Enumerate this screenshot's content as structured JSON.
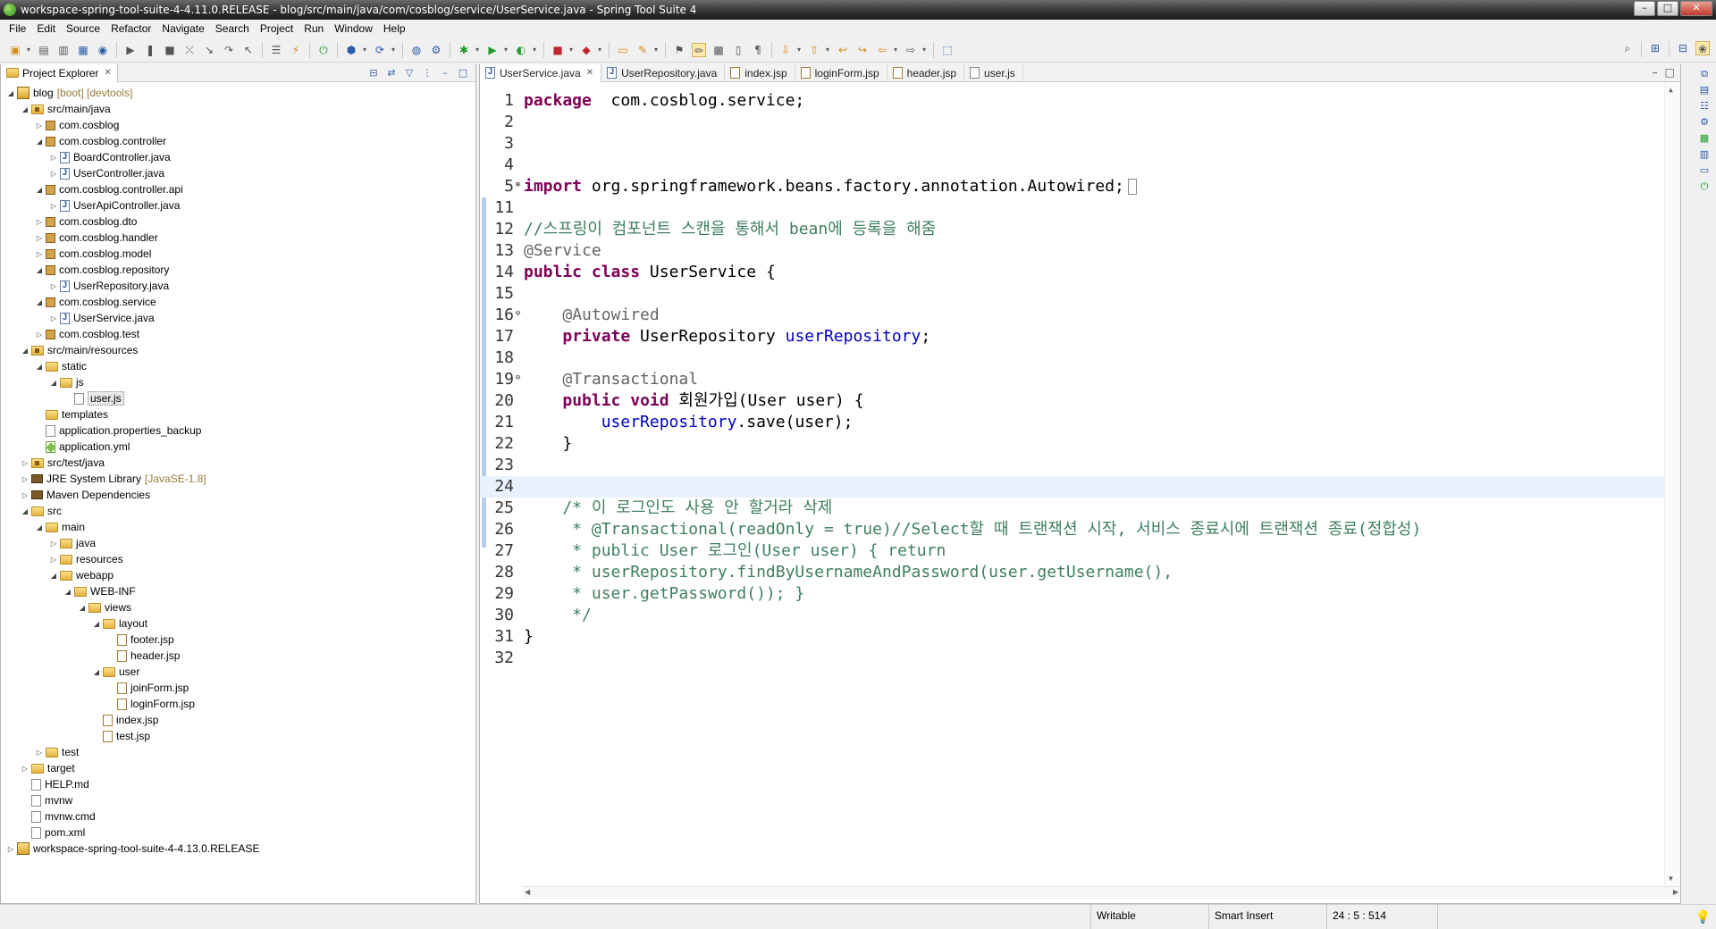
{
  "window": {
    "title": "workspace-spring-tool-suite-4-4.11.0.RELEASE - blog/src/main/java/com/cosblog/service/UserService.java - Spring Tool Suite 4",
    "buttons": [
      "–",
      "□",
      "✕"
    ]
  },
  "menu": [
    "File",
    "Edit",
    "Source",
    "Refactor",
    "Navigate",
    "Search",
    "Project",
    "Run",
    "Window",
    "Help"
  ],
  "explorer": {
    "tab_label": "Project Explorer",
    "close_glyph": "✕",
    "tree": [
      {
        "level": 0,
        "twisty": "◢",
        "icon": "proj",
        "label": "blog",
        "deco": "[boot] [devtools]"
      },
      {
        "level": 1,
        "twisty": "◢",
        "icon": "srcfolder",
        "label": "src/main/java"
      },
      {
        "level": 2,
        "twisty": "▷",
        "icon": "pkg",
        "label": "com.cosblog"
      },
      {
        "level": 2,
        "twisty": "◢",
        "icon": "pkg",
        "label": "com.cosblog.controller"
      },
      {
        "level": 3,
        "twisty": "▷",
        "icon": "java",
        "label": "BoardController.java"
      },
      {
        "level": 3,
        "twisty": "▷",
        "icon": "java",
        "label": "UserController.java"
      },
      {
        "level": 2,
        "twisty": "◢",
        "icon": "pkg",
        "label": "com.cosblog.controller.api"
      },
      {
        "level": 3,
        "twisty": "▷",
        "icon": "java",
        "label": "UserApiController.java"
      },
      {
        "level": 2,
        "twisty": "▷",
        "icon": "pkg",
        "label": "com.cosblog.dto"
      },
      {
        "level": 2,
        "twisty": "▷",
        "icon": "pkg",
        "label": "com.cosblog.handler"
      },
      {
        "level": 2,
        "twisty": "▷",
        "icon": "pkg",
        "label": "com.cosblog.model"
      },
      {
        "level": 2,
        "twisty": "◢",
        "icon": "pkg",
        "label": "com.cosblog.repository"
      },
      {
        "level": 3,
        "twisty": "▷",
        "icon": "java",
        "label": "UserRepository.java"
      },
      {
        "level": 2,
        "twisty": "◢",
        "icon": "pkg",
        "label": "com.cosblog.service"
      },
      {
        "level": 3,
        "twisty": "▷",
        "icon": "java",
        "label": "UserService.java"
      },
      {
        "level": 2,
        "twisty": "▷",
        "icon": "pkg",
        "label": "com.cosblog.test"
      },
      {
        "level": 1,
        "twisty": "◢",
        "icon": "srcfolder",
        "label": "src/main/resources"
      },
      {
        "level": 2,
        "twisty": "◢",
        "icon": "folder",
        "label": "static"
      },
      {
        "level": 3,
        "twisty": "◢",
        "icon": "folder",
        "label": "js"
      },
      {
        "level": 4,
        "twisty": "",
        "icon": "file",
        "label": "user.js",
        "selected": true
      },
      {
        "level": 2,
        "twisty": "",
        "icon": "folder",
        "label": "templates"
      },
      {
        "level": 2,
        "twisty": "",
        "icon": "file",
        "label": "application.properties_backup"
      },
      {
        "level": 2,
        "twisty": "",
        "icon": "yml",
        "label": "application.yml"
      },
      {
        "level": 1,
        "twisty": "▷",
        "icon": "srcfolder",
        "label": "src/test/java"
      },
      {
        "level": 1,
        "twisty": "▷",
        "icon": "lib",
        "label": "JRE System Library",
        "deco": "[JavaSE-1.8]"
      },
      {
        "level": 1,
        "twisty": "▷",
        "icon": "lib",
        "label": "Maven Dependencies"
      },
      {
        "level": 1,
        "twisty": "◢",
        "icon": "folder",
        "label": "src"
      },
      {
        "level": 2,
        "twisty": "◢",
        "icon": "folder",
        "label": "main"
      },
      {
        "level": 3,
        "twisty": "▷",
        "icon": "folder",
        "label": "java"
      },
      {
        "level": 3,
        "twisty": "▷",
        "icon": "folder",
        "label": "resources"
      },
      {
        "level": 3,
        "twisty": "◢",
        "icon": "folder",
        "label": "webapp"
      },
      {
        "level": 4,
        "twisty": "◢",
        "icon": "folder",
        "label": "WEB-INF"
      },
      {
        "level": 5,
        "twisty": "◢",
        "icon": "folder",
        "label": "views"
      },
      {
        "level": 6,
        "twisty": "◢",
        "icon": "folder",
        "label": "layout"
      },
      {
        "level": 7,
        "twisty": "",
        "icon": "jsp",
        "label": "footer.jsp"
      },
      {
        "level": 7,
        "twisty": "",
        "icon": "jsp",
        "label": "header.jsp"
      },
      {
        "level": 6,
        "twisty": "◢",
        "icon": "folder",
        "label": "user"
      },
      {
        "level": 7,
        "twisty": "",
        "icon": "jsp",
        "label": "joinForm.jsp"
      },
      {
        "level": 7,
        "twisty": "",
        "icon": "jsp",
        "label": "loginForm.jsp"
      },
      {
        "level": 6,
        "twisty": "",
        "icon": "jsp",
        "label": "index.jsp"
      },
      {
        "level": 6,
        "twisty": "",
        "icon": "jsp",
        "label": "test.jsp"
      },
      {
        "level": 2,
        "twisty": "▷",
        "icon": "folder",
        "label": "test"
      },
      {
        "level": 1,
        "twisty": "▷",
        "icon": "folder",
        "label": "target"
      },
      {
        "level": 1,
        "twisty": "",
        "icon": "file",
        "label": "HELP.md"
      },
      {
        "level": 1,
        "twisty": "",
        "icon": "file",
        "label": "mvnw"
      },
      {
        "level": 1,
        "twisty": "",
        "icon": "file",
        "label": "mvnw.cmd"
      },
      {
        "level": 1,
        "twisty": "",
        "icon": "file",
        "label": "pom.xml"
      },
      {
        "level": 0,
        "twisty": "▷",
        "icon": "proj",
        "label": "workspace-spring-tool-suite-4-4.13.0.RELEASE"
      }
    ]
  },
  "editor": {
    "tabs": [
      {
        "label": "UserService.java",
        "icon": "java",
        "active": true,
        "close": "✕"
      },
      {
        "label": "UserRepository.java",
        "icon": "java"
      },
      {
        "label": "index.jsp",
        "icon": "jsp"
      },
      {
        "label": "loginForm.jsp",
        "icon": "jsp"
      },
      {
        "label": "header.jsp",
        "icon": "jsp"
      },
      {
        "label": "user.js",
        "icon": "file"
      }
    ],
    "lines": [
      {
        "n": "1",
        "parts": [
          [
            "kw",
            "package"
          ],
          [
            "",
            "  com.cosblog.service;"
          ]
        ]
      },
      {
        "n": "2",
        "parts": []
      },
      {
        "n": "3",
        "parts": []
      },
      {
        "n": "4",
        "parts": []
      },
      {
        "n": "5",
        "fold": "⊕",
        "parts": [
          [
            "kw",
            "import"
          ],
          [
            "",
            " org.springframework.beans.factory.annotation.Autowired;"
          ]
        ],
        "box": true
      },
      {
        "n": "11",
        "parts": []
      },
      {
        "n": "12",
        "parts": [
          [
            "cm",
            "//스프링이 컴포넌트 스캔을 통해서 bean에 등록을 해줌"
          ]
        ]
      },
      {
        "n": "13",
        "parts": [
          [
            "an",
            "@Service"
          ]
        ]
      },
      {
        "n": "14",
        "parts": [
          [
            "kw",
            "public"
          ],
          [
            "",
            " "
          ],
          [
            "kw",
            "class"
          ],
          [
            "",
            " UserService {"
          ]
        ]
      },
      {
        "n": "15",
        "parts": []
      },
      {
        "n": "16",
        "fold": "⊖",
        "parts": [
          [
            "",
            "    "
          ],
          [
            "an",
            "@Autowired"
          ]
        ]
      },
      {
        "n": "17",
        "parts": [
          [
            "",
            "    "
          ],
          [
            "kw",
            "private"
          ],
          [
            "",
            " UserRepository "
          ],
          [
            "fld",
            "userRepository"
          ],
          [
            "",
            ";"
          ]
        ]
      },
      {
        "n": "18",
        "parts": []
      },
      {
        "n": "19",
        "fold": "⊖",
        "parts": [
          [
            "",
            "    "
          ],
          [
            "an",
            "@Transactional"
          ]
        ]
      },
      {
        "n": "20",
        "parts": [
          [
            "",
            "    "
          ],
          [
            "kw",
            "public"
          ],
          [
            "",
            " "
          ],
          [
            "kw",
            "void"
          ],
          [
            "",
            " 회원가입(User user) {"
          ]
        ]
      },
      {
        "n": "21",
        "parts": [
          [
            "",
            "        "
          ],
          [
            "fld",
            "userRepository"
          ],
          [
            "",
            ".save(user);"
          ]
        ]
      },
      {
        "n": "22",
        "parts": [
          [
            "",
            "    }"
          ]
        ]
      },
      {
        "n": "23",
        "parts": []
      },
      {
        "n": "24",
        "parts": [],
        "current": true
      },
      {
        "n": "25",
        "parts": [
          [
            "cm",
            "    /* 이 로그인도 사용 안 할거라 삭제"
          ]
        ]
      },
      {
        "n": "26",
        "parts": [
          [
            "cm",
            "     * @Transactional(readOnly = true)//Select할 때 트랜잭션 시작, 서비스 종료시에 트랜잭션 종료(정합성)"
          ]
        ]
      },
      {
        "n": "27",
        "parts": [
          [
            "cm",
            "     * public User 로그인(User user) { return"
          ]
        ]
      },
      {
        "n": "28",
        "parts": [
          [
            "cm",
            "     * userRepository.findByUsernameAndPassword(user.getUsername(),"
          ]
        ]
      },
      {
        "n": "29",
        "parts": [
          [
            "cm",
            "     * user.getPassword()); }"
          ]
        ]
      },
      {
        "n": "30",
        "parts": [
          [
            "cm",
            "     */"
          ]
        ]
      },
      {
        "n": "31",
        "parts": [
          [
            "",
            "}"
          ]
        ]
      },
      {
        "n": "32",
        "parts": []
      }
    ]
  },
  "status": {
    "writable": "Writable",
    "insert_mode": "Smart Insert",
    "position": "24 : 5 : 514"
  }
}
